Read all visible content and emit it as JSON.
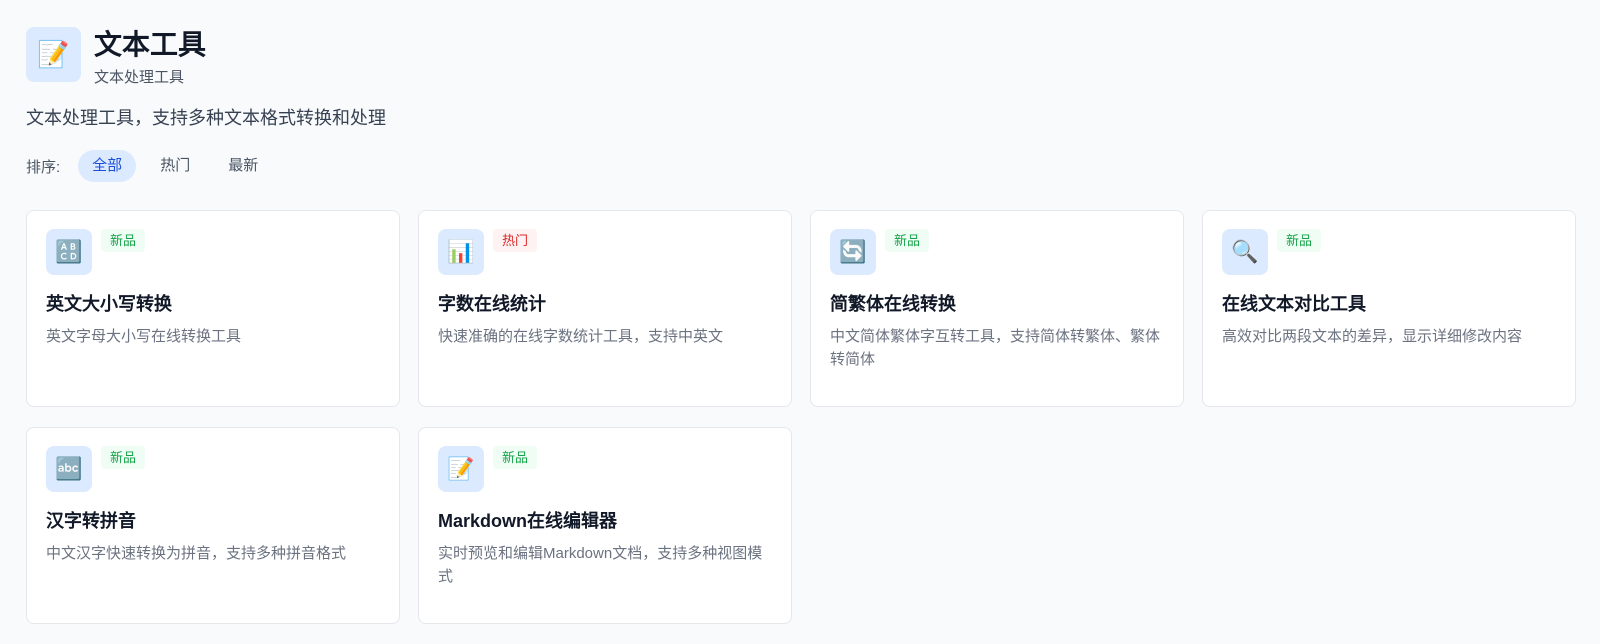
{
  "header": {
    "icon": "memo-icon",
    "icon_glyph": "📝",
    "title": "文本工具",
    "subtitle": "文本处理工具"
  },
  "description": "文本处理工具，支持多种文本格式转换和处理",
  "sort": {
    "label": "排序:",
    "options": [
      {
        "label": "全部",
        "active": true
      },
      {
        "label": "热门",
        "active": false
      },
      {
        "label": "最新",
        "active": false
      }
    ]
  },
  "tools": [
    {
      "icon": "abcd-icon",
      "glyph": "🔠",
      "badge": "新品",
      "badge_type": "new",
      "title": "英文大小写转换",
      "desc": "英文字母大小写在线转换工具"
    },
    {
      "icon": "bar-chart-icon",
      "glyph": "📊",
      "badge": "热门",
      "badge_type": "hot",
      "title": "字数在线统计",
      "desc": "快速准确的在线字数统计工具，支持中英文"
    },
    {
      "icon": "refresh-icon",
      "glyph": "🔄",
      "badge": "新品",
      "badge_type": "new",
      "title": "简繁体在线转换",
      "desc": "中文简体繁体字互转工具，支持简体转繁体、繁体转简体"
    },
    {
      "icon": "magnifier-icon",
      "glyph": "🔍",
      "badge": "新品",
      "badge_type": "new",
      "title": "在线文本对比工具",
      "desc": "高效对比两段文本的差异，显示详细修改内容"
    },
    {
      "icon": "abc-icon",
      "glyph": "🔤",
      "badge": "新品",
      "badge_type": "new",
      "title": "汉字转拼音",
      "desc": "中文汉字快速转换为拼音，支持多种拼音格式"
    },
    {
      "icon": "memo-icon",
      "glyph": "📝",
      "badge": "新品",
      "badge_type": "new",
      "title": "Markdown在线编辑器",
      "desc": "实时预览和编辑Markdown文档，支持多种视图模式"
    }
  ],
  "colors": {
    "accent": "#1d4ed8",
    "new_badge": "#16a34a",
    "hot_badge": "#dc2626"
  }
}
